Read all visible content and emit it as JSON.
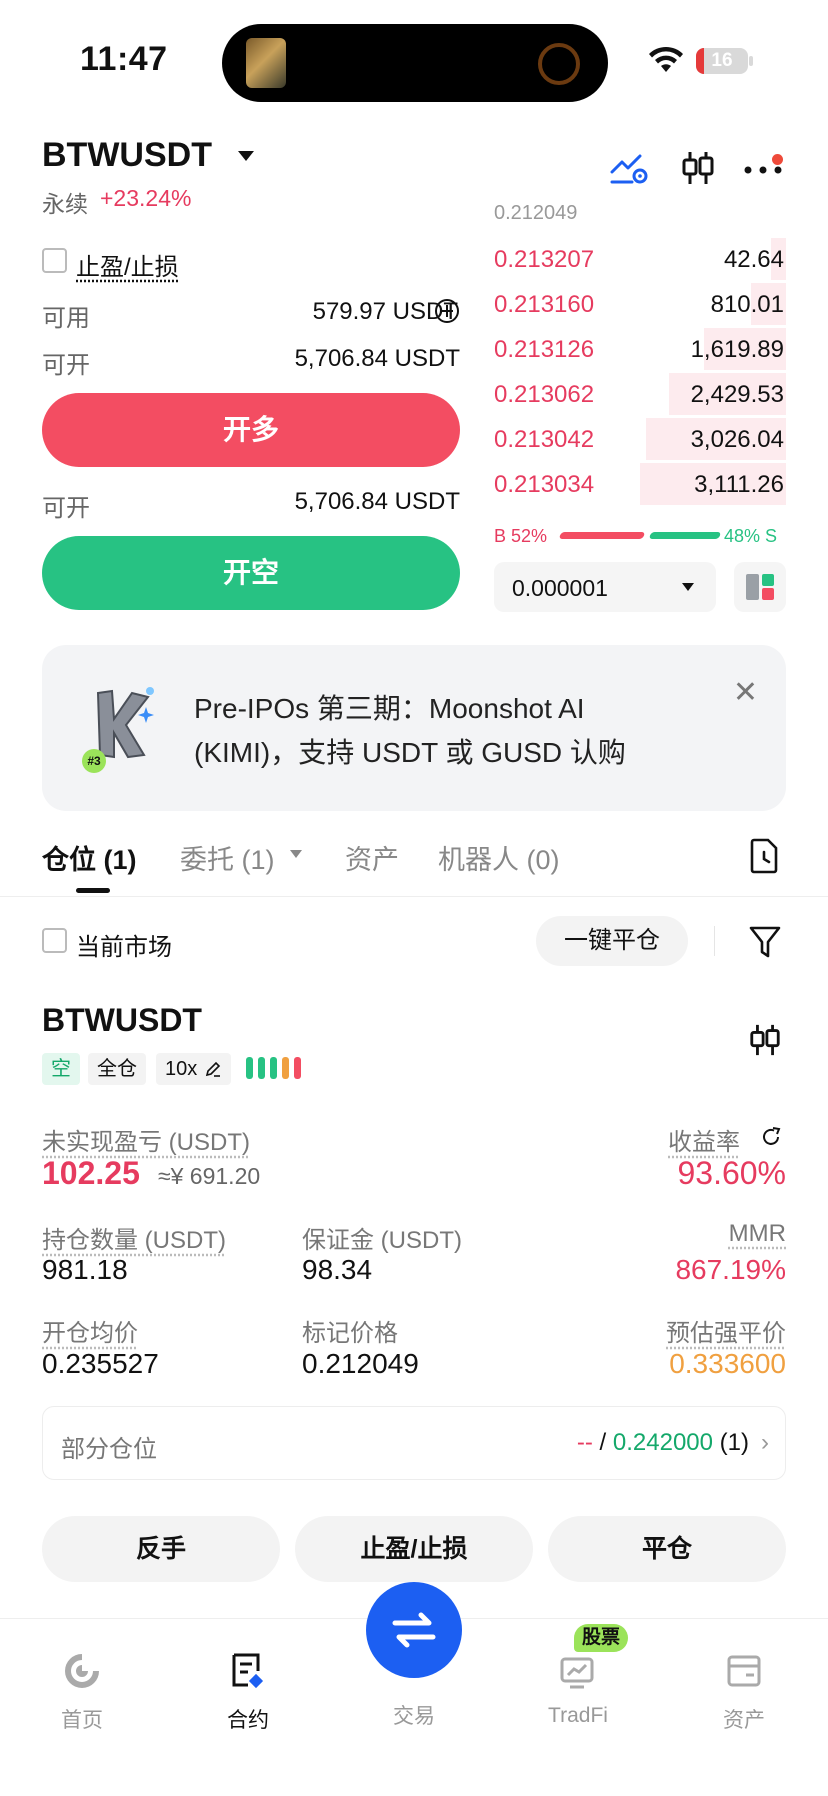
{
  "status_bar": {
    "time": "11:47",
    "battery": "16"
  },
  "header": {
    "pair": "BTWUSDT",
    "contract_type": "永续",
    "change": "+23.24%"
  },
  "trade_panel": {
    "tpsl_label": "止盈/止损",
    "available_label": "可用",
    "available_value": "579.97 USDT",
    "openable_label": "可开",
    "openable_long_value": "5,706.84 USDT",
    "long_button": "开多",
    "openable_short_value": "5,706.84 USDT",
    "short_button": "开空"
  },
  "orderbook": {
    "partial_top": "0.212049",
    "asks": [
      {
        "price": "0.213207",
        "qty": "42.64",
        "depth": 0.05
      },
      {
        "price": "0.213160",
        "qty": "810.01",
        "depth": 0.12
      },
      {
        "price": "0.213126",
        "qty": "1,619.89",
        "depth": 0.28
      },
      {
        "price": "0.213062",
        "qty": "2,429.53",
        "depth": 0.4
      },
      {
        "price": "0.213042",
        "qty": "3,026.04",
        "depth": 0.48
      },
      {
        "price": "0.213034",
        "qty": "3,111.26",
        "depth": 0.5
      }
    ],
    "buy_ratio": "B 52%",
    "sell_ratio": "48% S",
    "precision": "0.000001"
  },
  "banner": {
    "line1": "Pre-IPOs 第三期：Moonshot AI",
    "line2": "(KIMI)，支持 USDT 或 GUSD 认购",
    "badge": "#3"
  },
  "tabs": [
    {
      "label": "仓位 (1)"
    },
    {
      "label": "委托 (1)"
    },
    {
      "label": "资产"
    },
    {
      "label": "机器人 (0)"
    }
  ],
  "filter": {
    "current_market": "当前市场",
    "close_all": "一键平仓"
  },
  "position": {
    "symbol": "BTWUSDT",
    "side_tag": "空",
    "margin_tag": "全仓",
    "leverage_tag": "10x",
    "upnl_label": "未实现盈亏 (USDT)",
    "upnl_value": "102.25",
    "upnl_cny": "≈¥ 691.20",
    "roe_label": "收益率",
    "roe_value": "93.60%",
    "size_label": "持仓数量 (USDT)",
    "size_value": "981.18",
    "margin_label": "保证金 (USDT)",
    "margin_value": "98.34",
    "mmr_label": "MMR",
    "mmr_value": "867.19%",
    "entry_label": "开仓均价",
    "entry_value": "0.235527",
    "mark_label": "标记价格",
    "mark_value": "0.212049",
    "liq_label": "预估强平价",
    "liq_value": "0.333600",
    "partial_label": "部分仓位",
    "partial_dash": "--",
    "partial_sep": " / ",
    "partial_price": "0.242000",
    "partial_count": " (1)"
  },
  "actions": {
    "reverse": "反手",
    "tpsl": "止盈/止损",
    "close": "平仓"
  },
  "bottom_nav": {
    "home": "首页",
    "futures": "合约",
    "trade": "交易",
    "tradfi": "TradFi",
    "tradfi_badge": "股票",
    "assets": "资产"
  },
  "colors": {
    "red": "#f34d62",
    "green": "#27c283",
    "blue": "#1c5ff2",
    "orange": "#f0a040"
  }
}
